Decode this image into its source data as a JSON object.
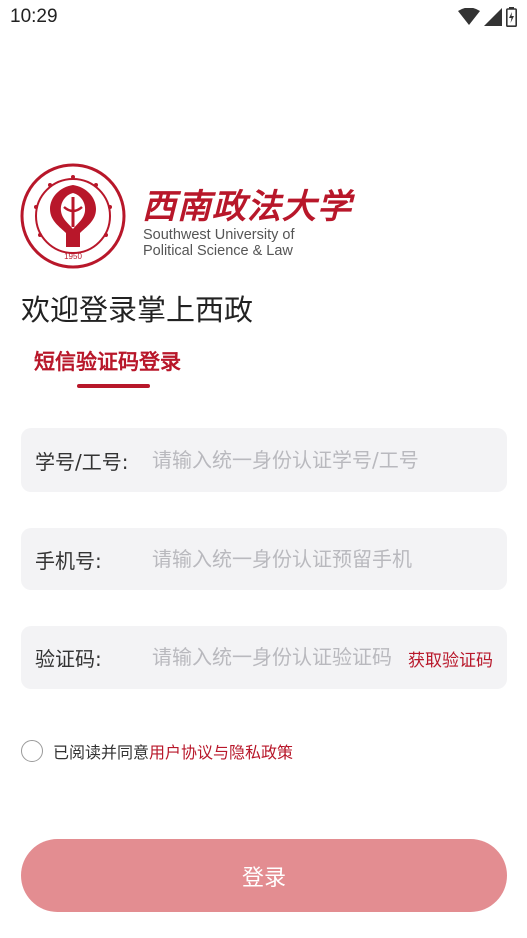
{
  "status_bar": {
    "time": "10:29",
    "icons": [
      "wifi-icon",
      "signal-icon",
      "battery-icon"
    ]
  },
  "logo": {
    "seal_year": "1950",
    "name_cn": "西南政法大学",
    "name_en_line1": "Southwest University of",
    "name_en_line2": "Political Science & Law"
  },
  "welcome_title": "欢迎登录掌上西政",
  "tab_label": "短信验证码登录",
  "fields": {
    "student_id": {
      "label": "学号/工号:",
      "placeholder": "请输入统一身份认证学号/工号",
      "value": ""
    },
    "phone": {
      "label": "手机号:",
      "placeholder": "请输入统一身份认证预留手机号",
      "value": ""
    },
    "code": {
      "label": "验证码:",
      "placeholder": "请输入统一身份认证验证码",
      "value": "",
      "get_code_label": "获取验证码"
    }
  },
  "agreement": {
    "prefix": "已阅读并同意",
    "link": "用户协议与隐私政策",
    "checked": false
  },
  "login_button": "登录",
  "colors": {
    "brand": "#b8172a",
    "button": "#e38d91",
    "field_bg": "#f3f3f5",
    "placeholder": "#b9b9be"
  }
}
